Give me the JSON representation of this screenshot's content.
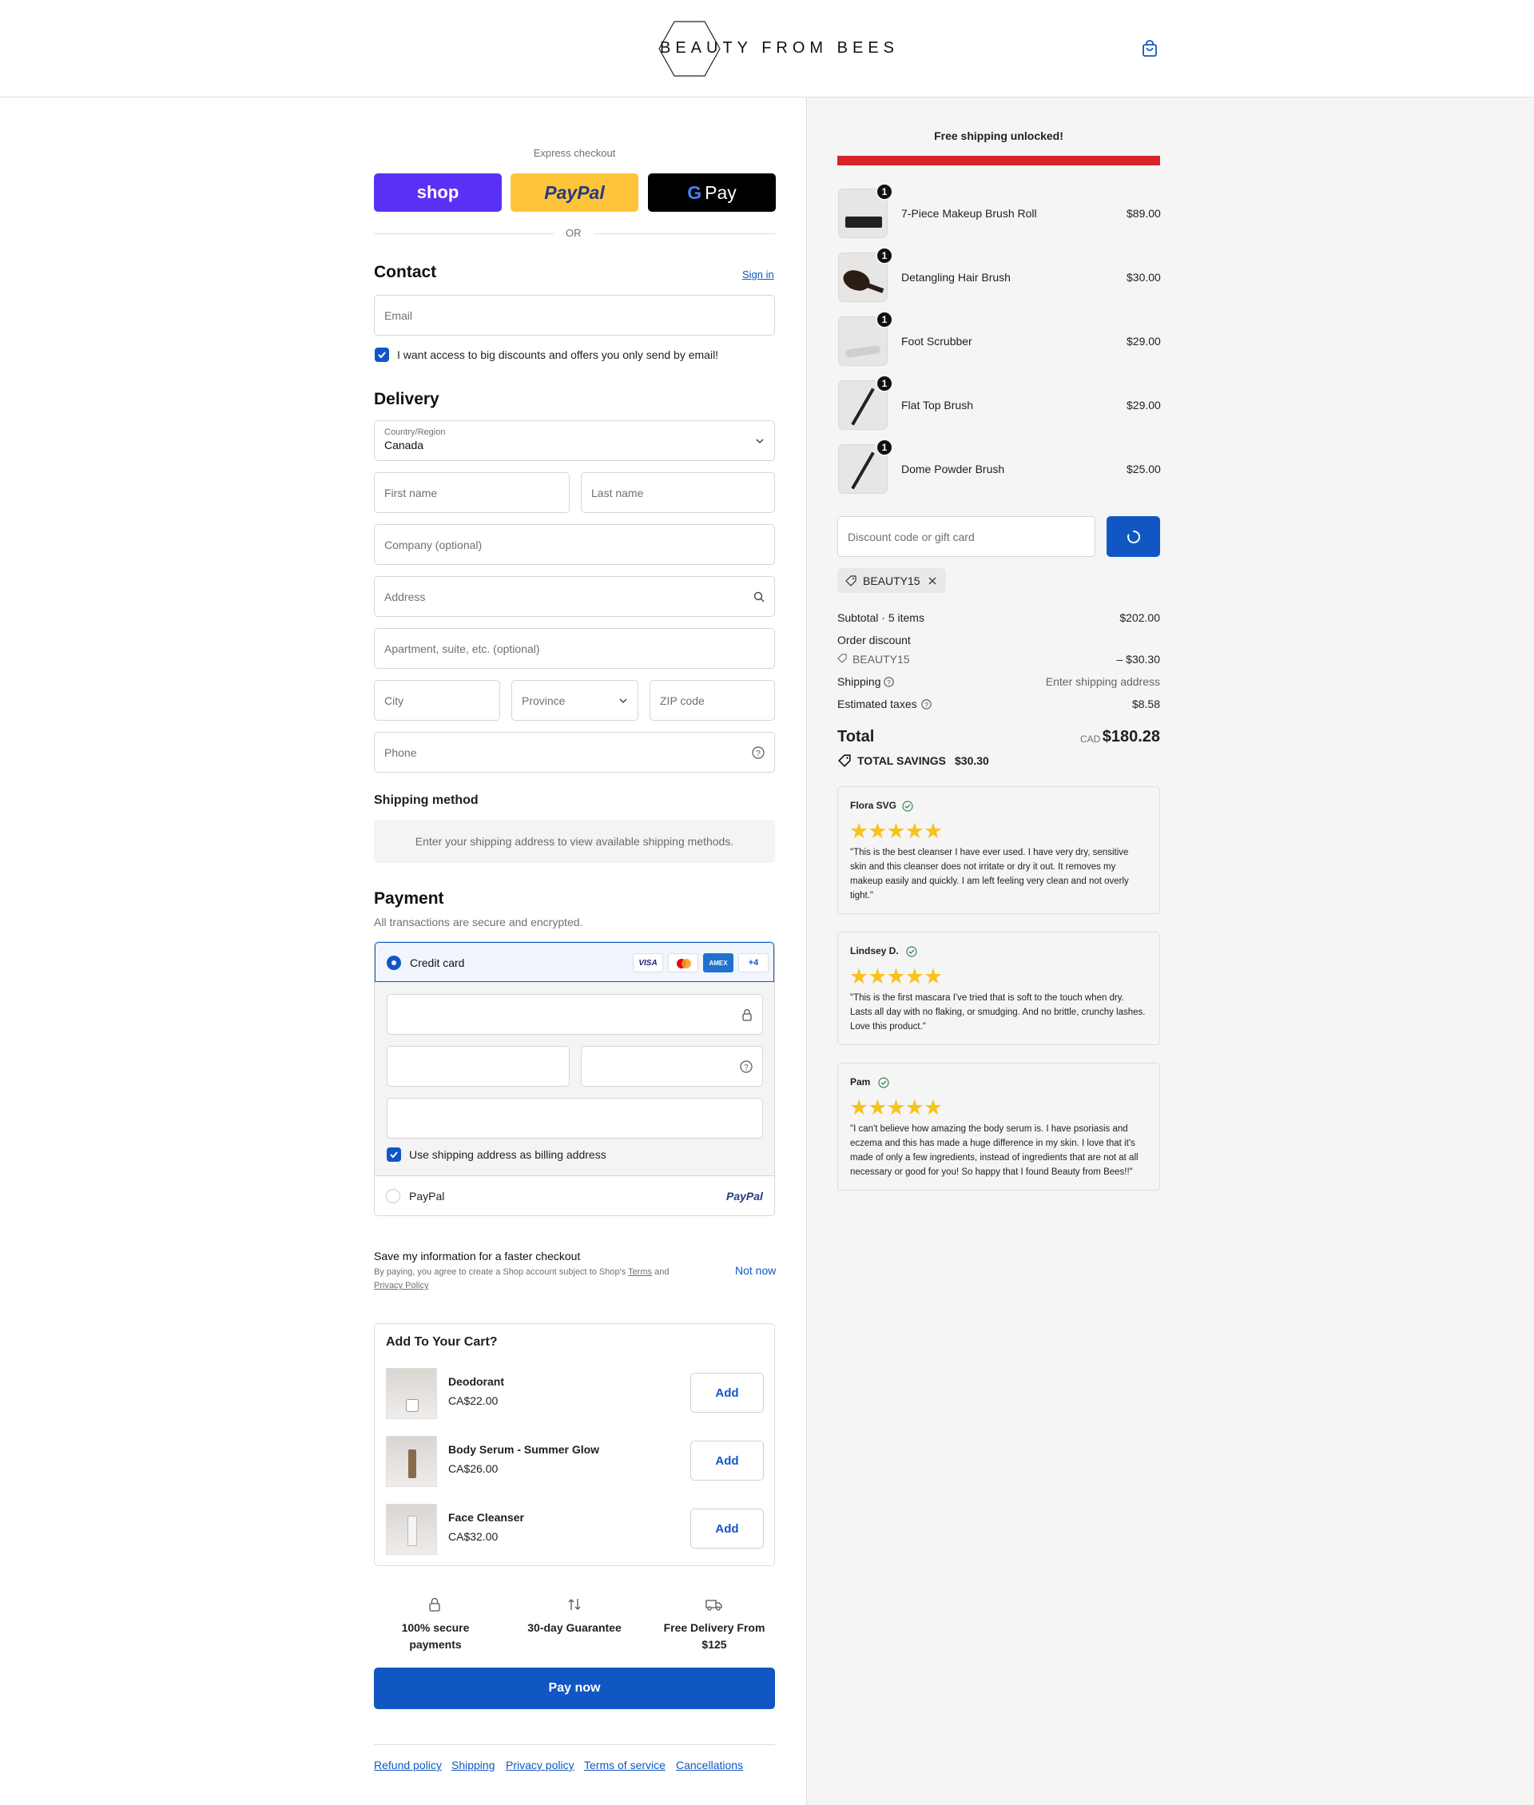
{
  "brand": {
    "name": "BEAUTY FROM BEES"
  },
  "express": {
    "label": "Express checkout",
    "shop": "shop",
    "paypal": "PayPal",
    "gpay": "Pay",
    "gpay_g": "G",
    "or": "OR"
  },
  "contact": {
    "title": "Contact",
    "sign_in": "Sign in",
    "email_placeholder": "Email",
    "marketing_optin": "I want access to big discounts and offers you only send by email!"
  },
  "delivery": {
    "title": "Delivery",
    "country_label": "Country/Region",
    "country_value": "Canada",
    "first_name": "First name",
    "last_name": "Last name",
    "company": "Company (optional)",
    "address": "Address",
    "apartment": "Apartment, suite, etc. (optional)",
    "city": "City",
    "province": "Province",
    "zip": "ZIP code",
    "phone": "Phone"
  },
  "shipping_method": {
    "title": "Shipping method",
    "notice": "Enter your shipping address to view available shipping methods."
  },
  "payment": {
    "title": "Payment",
    "subtitle": "All transactions are secure and encrypted.",
    "credit_card": "Credit card",
    "card_brands": [
      "VISA",
      "AMEX",
      "+4"
    ],
    "billing_same": "Use shipping address as billing address",
    "paypal": "PayPal",
    "paypal_logo": "PayPal"
  },
  "save_info": {
    "title": "Save my information for a faster checkout",
    "text": "By paying, you agree to create a Shop account subject to Shop's",
    "terms": "Terms",
    "and": "and",
    "privacy": "Privacy Policy",
    "not_now": "Not now"
  },
  "upsell": {
    "title": "Add To Your Cart?",
    "items": [
      {
        "name": "Deodorant",
        "price": "CA$22.00",
        "button": "Add"
      },
      {
        "name": "Body Serum - Summer Glow",
        "price": "CA$26.00",
        "button": "Add"
      },
      {
        "name": "Face Cleanser",
        "price": "CA$32.00",
        "button": "Add"
      }
    ]
  },
  "trust": [
    {
      "line1": "100% secure",
      "line2": "payments",
      "icon": "lock-icon"
    },
    {
      "line1": "30-day Guarantee",
      "line2": "",
      "icon": "exchange-arrows-icon"
    },
    {
      "line1": "Free Delivery From",
      "line2": "$125",
      "icon": "delivery-truck-icon"
    }
  ],
  "pay_now": "Pay now",
  "footer_links": [
    "Refund policy",
    "Shipping",
    "Privacy policy",
    "Terms of service",
    "Cancellations"
  ],
  "summary": {
    "free_shipping": "Free shipping unlocked!",
    "progress_fraction": 1.0,
    "progress_color": "#d9232a",
    "items": [
      {
        "name": "7-Piece Makeup Brush Roll",
        "price": "$89.00",
        "qty": "1"
      },
      {
        "name": "Detangling Hair Brush",
        "price": "$30.00",
        "qty": "1"
      },
      {
        "name": "Foot Scrubber",
        "price": "$29.00",
        "qty": "1"
      },
      {
        "name": "Flat Top Brush",
        "price": "$29.00",
        "qty": "1"
      },
      {
        "name": "Dome Powder Brush",
        "price": "$25.00",
        "qty": "1"
      }
    ],
    "discount_placeholder": "Discount code or gift card",
    "applied_code": "BEAUTY15",
    "subtotal_label": "Subtotal · 5 items",
    "subtotal_value": "$202.00",
    "order_discount_label": "Order discount",
    "discount_code": "BEAUTY15",
    "discount_value": "– $30.30",
    "shipping_label": "Shipping",
    "shipping_value": "Enter shipping address",
    "taxes_label": "Estimated taxes",
    "taxes_value": "$8.58",
    "total_label": "Total",
    "currency": "CAD",
    "total_value": "$180.28",
    "savings_label": "TOTAL SAVINGS",
    "savings_value": "$30.30"
  },
  "reviews": [
    {
      "name": "Flora SVG",
      "stars": "★★★★★",
      "text": "\"This is the best cleanser I have ever used. I have very dry, sensitive skin and this cleanser does not irritate or dry it out. It removes my makeup easily and quickly. I am left feeling very clean and not overly tight.\""
    },
    {
      "name": "Lindsey D.",
      "stars": "★★★★★",
      "text": "\"This is the first mascara I've tried that is soft to the touch when dry. Lasts all day with no flaking, or smudging. And no brittle, crunchy lashes. Love this product.\""
    },
    {
      "name": "Pam",
      "stars": "★★★★★",
      "text": "\"I can't believe how amazing the body serum is. I have psoriasis and eczema and this has made a huge difference in my skin. I love that it's made of only a few ingredients, instead of ingredients that are not at all necessary or good for you! So happy that I found Beauty from Bees!!\""
    }
  ]
}
